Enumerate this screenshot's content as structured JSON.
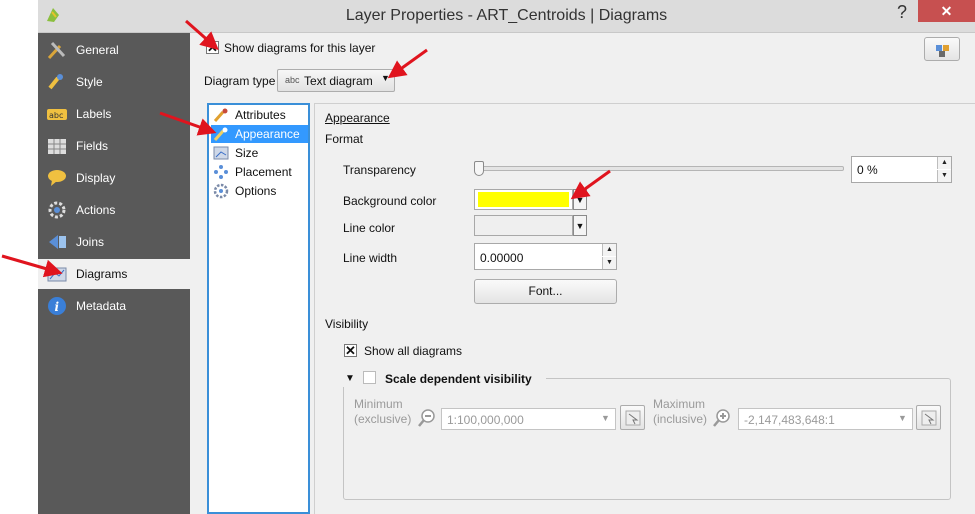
{
  "window": {
    "title": "Layer Properties - ART_Centroids | Diagrams",
    "help": "?",
    "close": "✕"
  },
  "sidebar": {
    "items": [
      {
        "label": "General",
        "icon": "wrench-icon"
      },
      {
        "label": "Style",
        "icon": "brush-icon"
      },
      {
        "label": "Labels",
        "icon": "abc-label-icon"
      },
      {
        "label": "Fields",
        "icon": "table-icon"
      },
      {
        "label": "Display",
        "icon": "speech-bubble-icon"
      },
      {
        "label": "Actions",
        "icon": "gear-icon"
      },
      {
        "label": "Joins",
        "icon": "join-icon"
      },
      {
        "label": "Diagrams",
        "icon": "diagram-icon"
      },
      {
        "label": "Metadata",
        "icon": "info-icon"
      }
    ],
    "active": "Diagrams"
  },
  "top": {
    "show_diagrams_label": "Show diagrams for this layer",
    "show_diagrams_checked": "✕",
    "diagram_type_label": "Diagram type",
    "diagram_type_icon_text": "abc",
    "diagram_type_value": "Text diagram"
  },
  "subnav": {
    "items": [
      {
        "label": "Attributes"
      },
      {
        "label": "Appearance"
      },
      {
        "label": "Size"
      },
      {
        "label": "Placement"
      },
      {
        "label": "Options"
      }
    ],
    "selected": "Appearance"
  },
  "appearance": {
    "heading": "Appearance",
    "format_label": "Format",
    "transparency_label": "Transparency",
    "transparency_value": "0 %",
    "background_color_label": "Background color",
    "background_color": "#ffff00",
    "line_color_label": "Line color",
    "line_width_label": "Line width",
    "line_width_value": "0.00000",
    "font_button": "Font..."
  },
  "visibility": {
    "heading": "Visibility",
    "show_all_label": "Show all diagrams",
    "show_all_checked": "✕",
    "scale_label": "Scale dependent visibility",
    "min_label_1": "Minimum",
    "min_label_2": "(exclusive)",
    "min_value": "1:100,000,000",
    "max_label_1": "Maximum",
    "max_label_2": "(inclusive)",
    "max_value": "-2,147,483,648:1"
  },
  "colors": {
    "sidebar_bg": "#595959",
    "selection": "#3399ff",
    "arrow": "#e0141e"
  }
}
